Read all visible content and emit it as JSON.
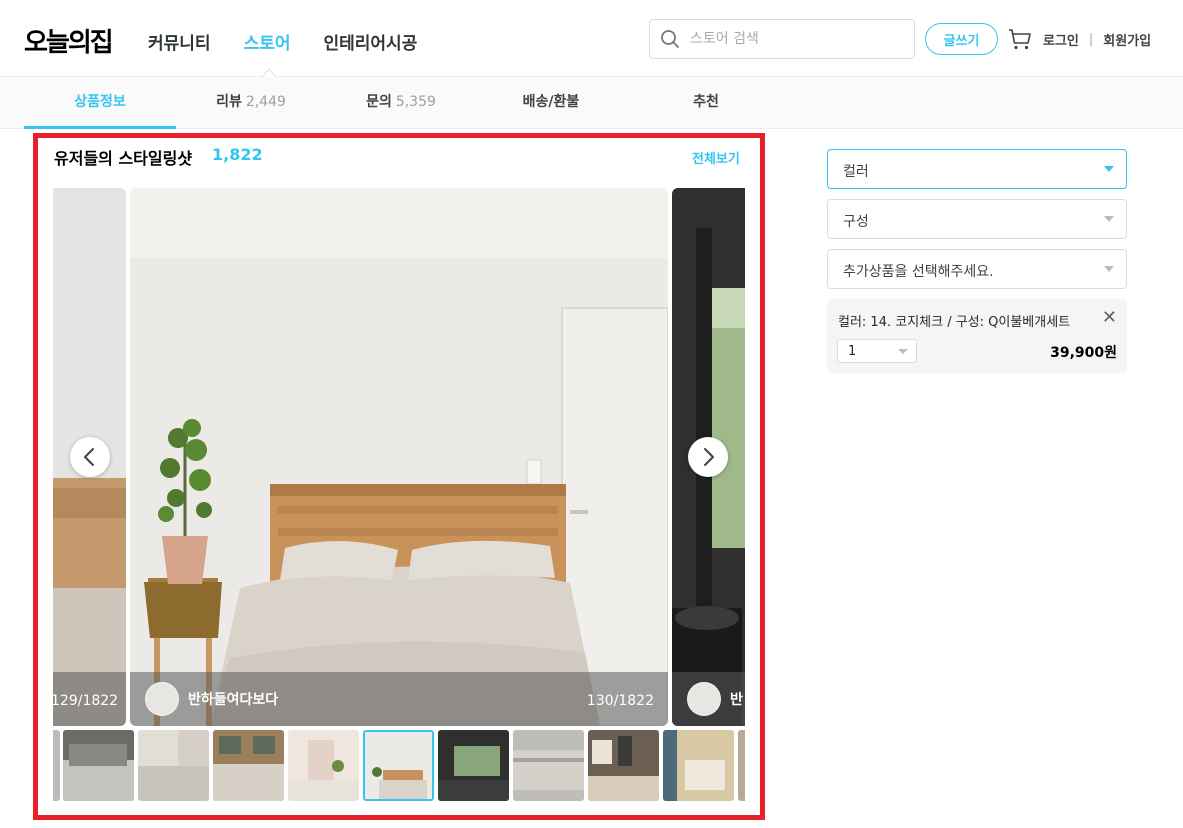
{
  "header": {
    "logo": "오늘의집",
    "nav": [
      "커뮤니티",
      "스토어",
      "인테리어시공"
    ],
    "search_placeholder": "스토어 검색",
    "write_label": "글쓰기",
    "login": "로그인",
    "signup": "회원가입"
  },
  "subtabs": [
    {
      "label": "상품정보",
      "count": ""
    },
    {
      "label": "리뷰",
      "count": "2,449"
    },
    {
      "label": "문의",
      "count": "5,359"
    },
    {
      "label": "배송/환불",
      "count": ""
    },
    {
      "label": "추천",
      "count": ""
    }
  ],
  "styling": {
    "title": "유저들의 스타일링샷",
    "count": "1,822",
    "view_all": "전체보기",
    "prev_counter": "129/1822",
    "current_user": "반하들여다보다",
    "current_counter": "130/1822",
    "next_user": "반"
  },
  "options": {
    "color_label": "컬러",
    "composition_label": "구성",
    "addon_label": "추가상품을 선택해주세요.",
    "selected_text": "컬러: 14. 코지체크 / 구성: Q이불베개세트",
    "quantity": "1",
    "price": "39,900원"
  },
  "colors": {
    "accent": "#35c5f0",
    "highlight": "#e8202a"
  }
}
